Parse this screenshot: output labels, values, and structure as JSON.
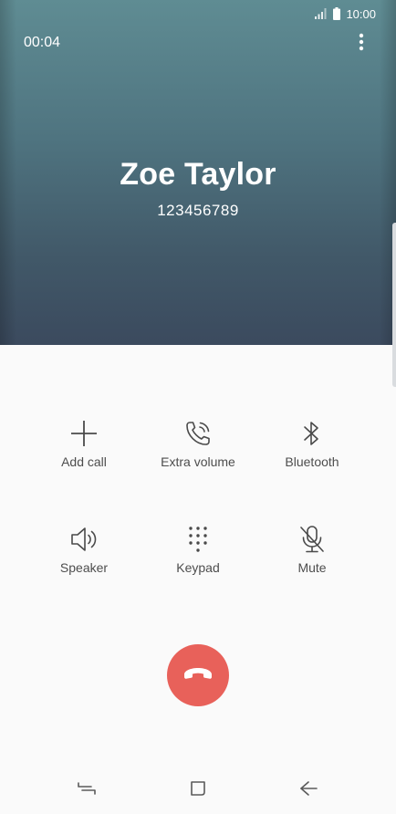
{
  "status_bar": {
    "time": "10:00",
    "icons": [
      "signal-icon",
      "battery-icon"
    ]
  },
  "call": {
    "timer": "00:04",
    "caller_name": "Zoe Taylor",
    "caller_number": "123456789"
  },
  "actions": [
    {
      "label": "Add call",
      "icon": "plus-icon"
    },
    {
      "label": "Extra volume",
      "icon": "phone-volume-icon"
    },
    {
      "label": "Bluetooth",
      "icon": "bluetooth-icon"
    },
    {
      "label": "Speaker",
      "icon": "speaker-icon"
    },
    {
      "label": "Keypad",
      "icon": "keypad-icon"
    },
    {
      "label": "Mute",
      "icon": "mic-off-icon"
    }
  ],
  "end_call": {
    "icon": "end-call-icon"
  },
  "nav": {
    "icons": [
      "recents-icon",
      "home-icon",
      "back-icon"
    ]
  },
  "colors": {
    "header_top": "#5f8c93",
    "header_bottom": "#3b4a5e",
    "end_call": "#e8615a",
    "background": "#fafafa",
    "label_text": "#4d4d4d"
  }
}
